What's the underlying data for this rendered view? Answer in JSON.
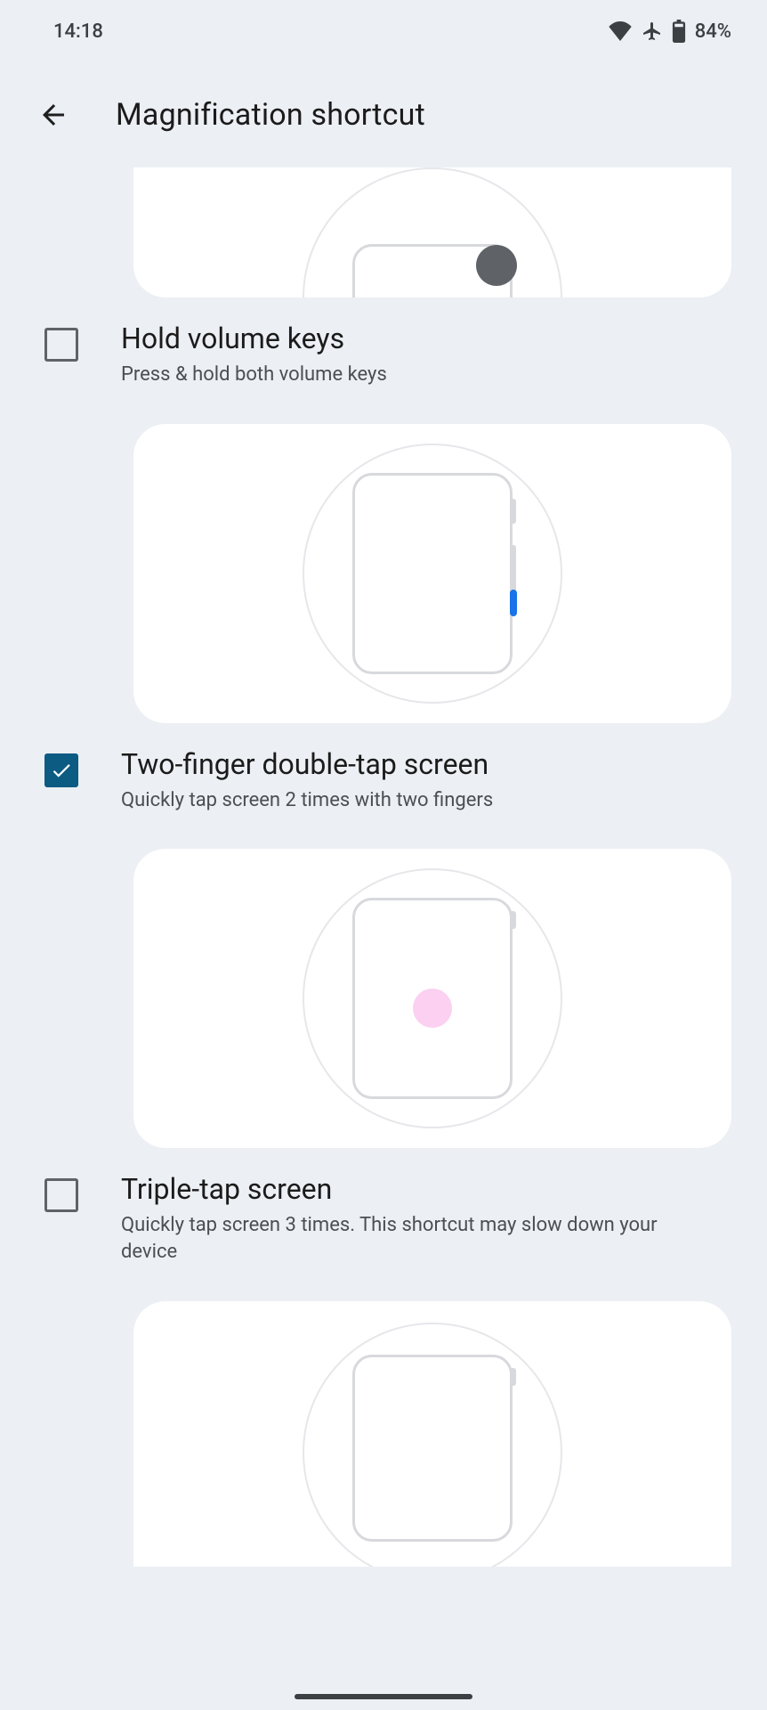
{
  "status": {
    "time": "14:18",
    "battery_pct": "84%"
  },
  "header": {
    "title": "Magnification shortcut"
  },
  "options": [
    {
      "title": "Hold volume keys",
      "subtitle": "Press & hold both volume keys",
      "checked": false
    },
    {
      "title": "Two-finger double-tap screen",
      "subtitle": "Quickly tap screen 2 times with two fingers",
      "checked": true
    },
    {
      "title": "Triple-tap screen",
      "subtitle": "Quickly tap screen 3 times. This shortcut may slow down your device",
      "checked": false
    }
  ]
}
